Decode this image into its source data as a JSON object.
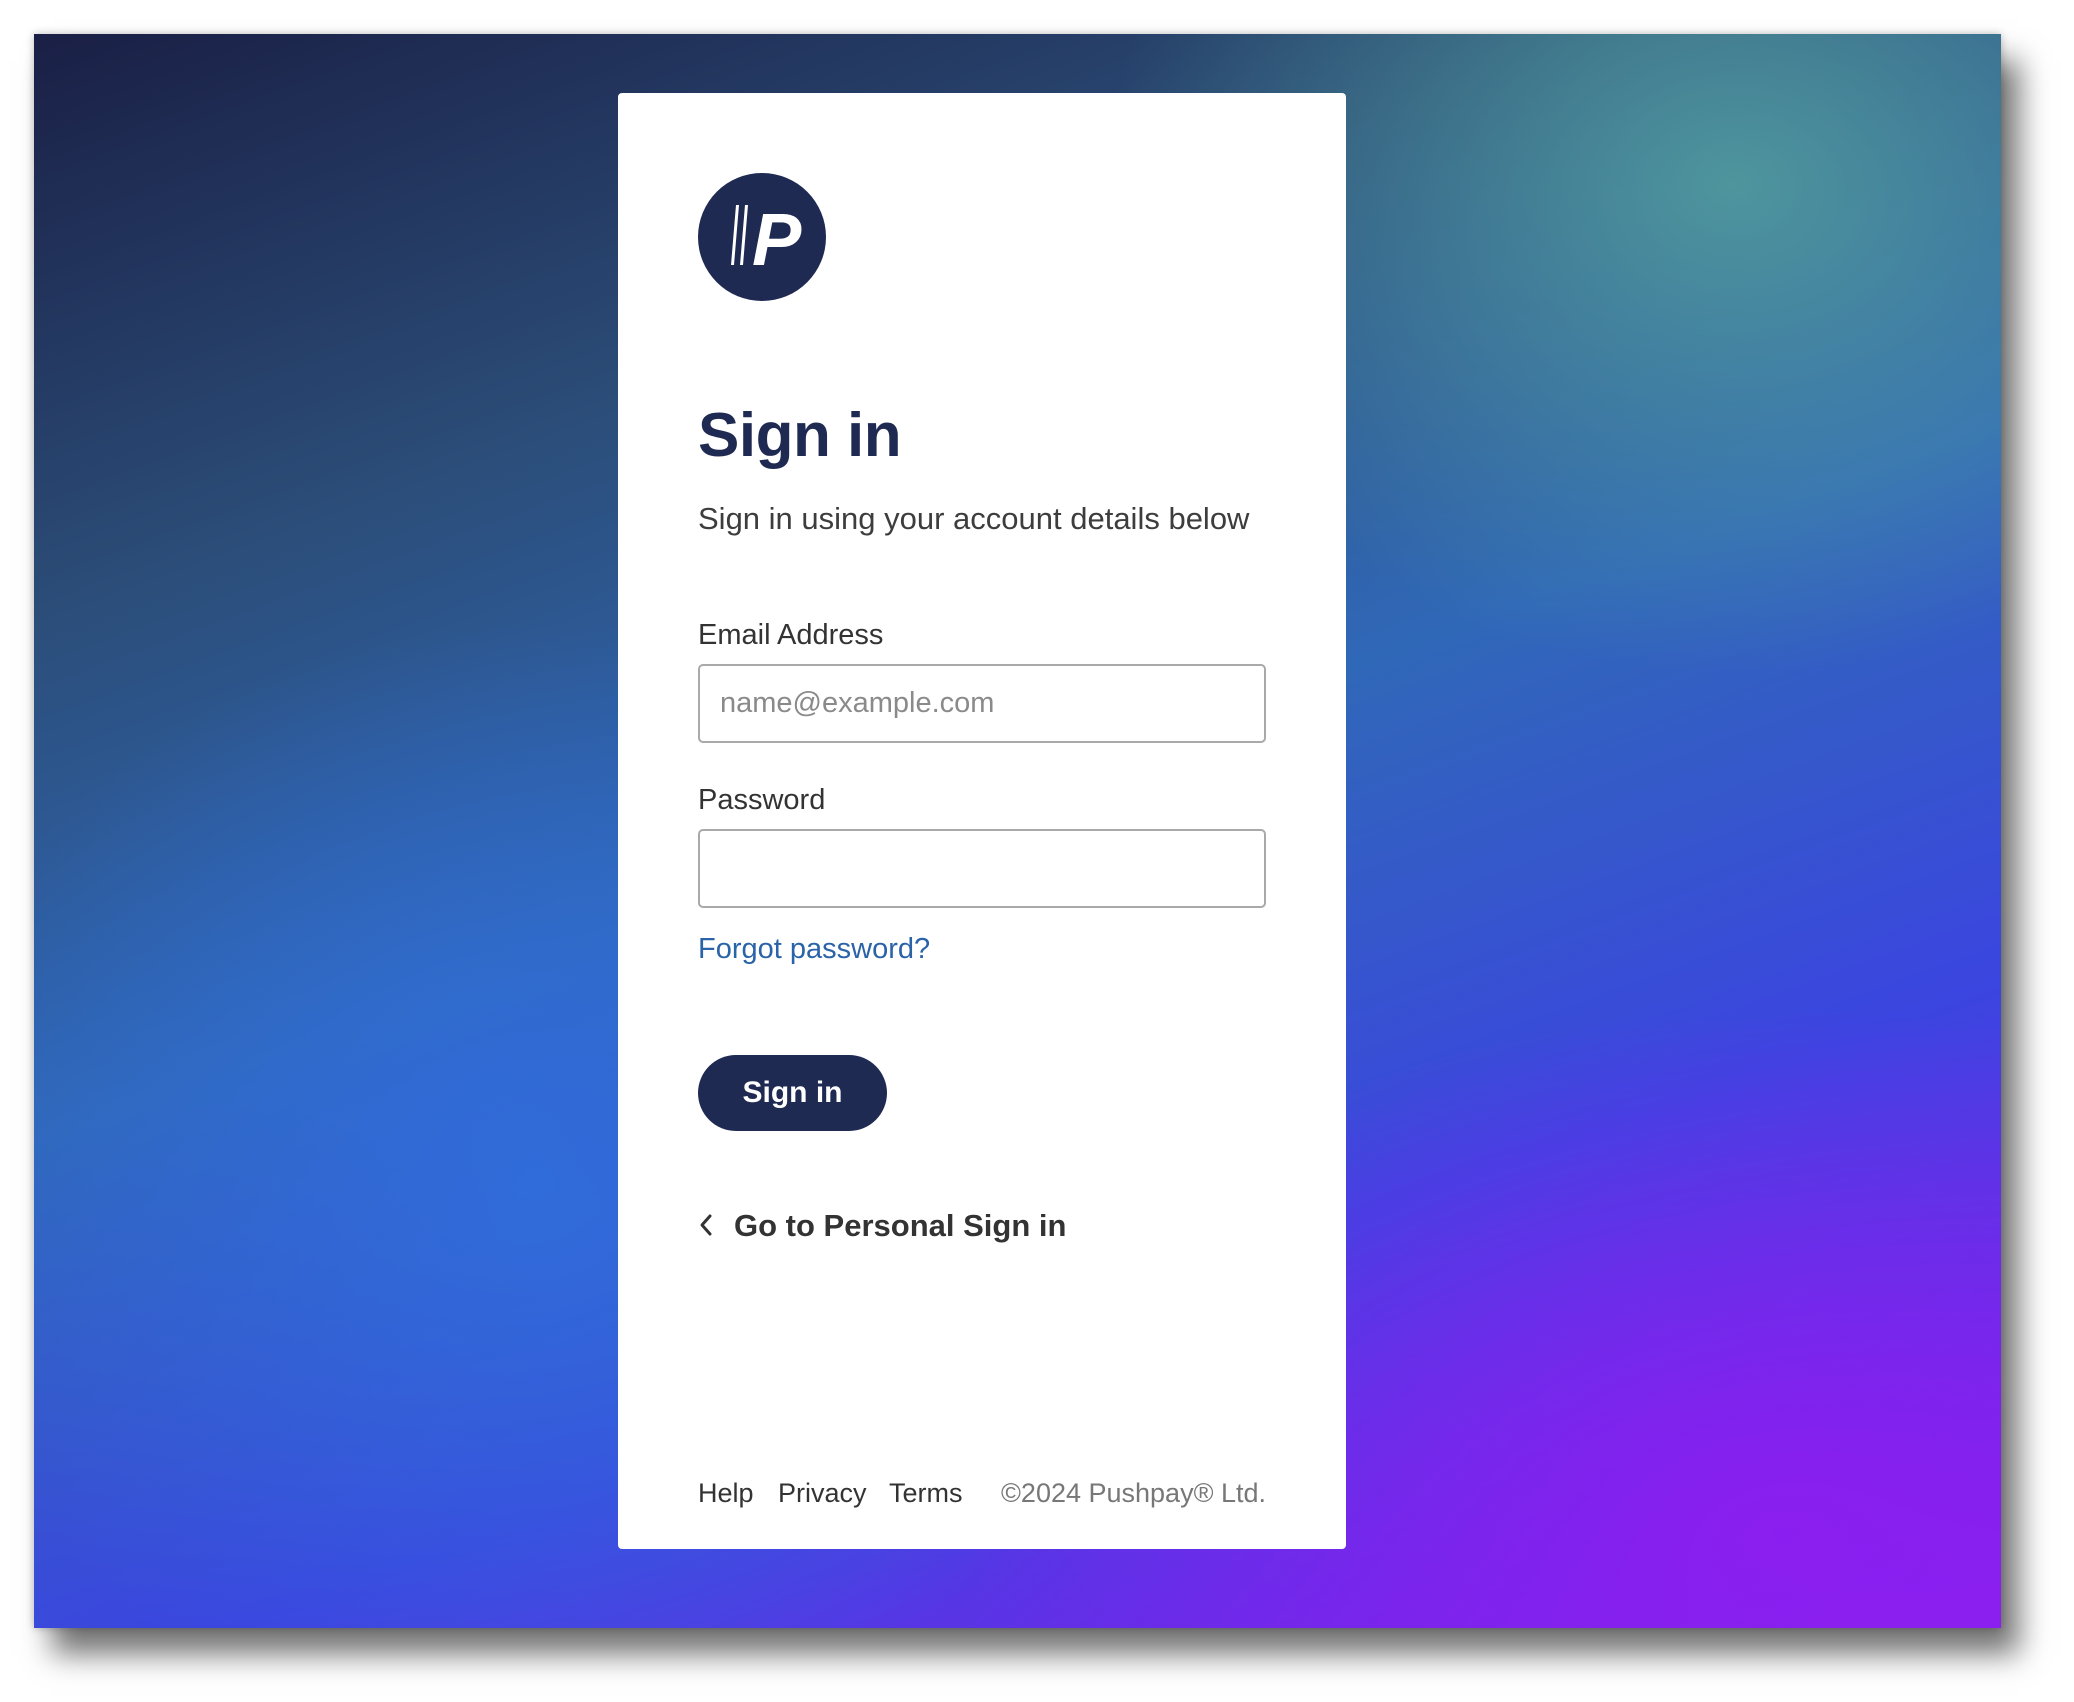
{
  "brand": {
    "logo_icon": "pushpay-p-logo-icon",
    "logo_color": "#1f2a52"
  },
  "heading": {
    "title": "Sign in",
    "subtitle": "Sign in using your account details below"
  },
  "form": {
    "email_label": "Email Address",
    "email_placeholder": "name@example.com",
    "email_value": "",
    "password_label": "Password",
    "password_value": "",
    "forgot_link": "Forgot password?",
    "submit_label": "Sign in"
  },
  "personal_link": {
    "icon": "chevron-left-icon",
    "label": "Go to Personal Sign in"
  },
  "footer": {
    "links": [
      "Help",
      "Privacy",
      "Terms"
    ],
    "copyright": "©2024 Pushpay® Ltd."
  },
  "colors": {
    "primary": "#1f2a52",
    "link": "#2a63a8"
  }
}
